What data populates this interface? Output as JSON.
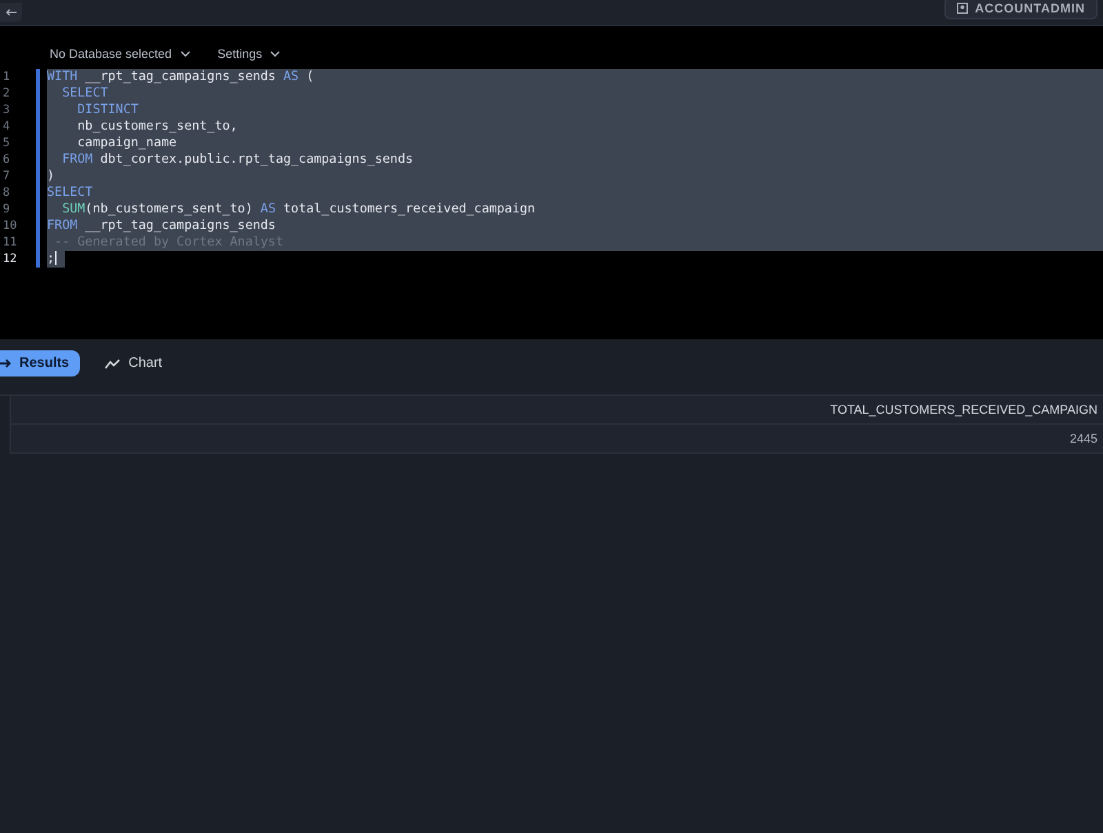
{
  "top_bar": {
    "role_button": "ACCOUNTADMIN"
  },
  "toolbar": {
    "database": "No Database selected",
    "settings": "Settings"
  },
  "editor": {
    "lines": [
      {
        "number": "1",
        "selected": true,
        "current": false,
        "tokens": [
          {
            "kind": "keyword",
            "text": "WITH"
          },
          {
            "kind": "plain",
            "text": " __rpt_tag_campaigns_sends "
          },
          {
            "kind": "keyword",
            "text": "AS"
          },
          {
            "kind": "plain",
            "text": " ("
          }
        ]
      },
      {
        "number": "2",
        "selected": true,
        "current": false,
        "tokens": [
          {
            "kind": "keyword",
            "text": "  SELECT"
          }
        ]
      },
      {
        "number": "3",
        "selected": true,
        "current": false,
        "tokens": [
          {
            "kind": "keyword",
            "text": "    DISTINCT"
          }
        ]
      },
      {
        "number": "4",
        "selected": true,
        "current": false,
        "tokens": [
          {
            "kind": "plain",
            "text": "    nb_customers_sent_to,"
          }
        ]
      },
      {
        "number": "5",
        "selected": true,
        "current": false,
        "tokens": [
          {
            "kind": "plain",
            "text": "    campaign_name"
          }
        ]
      },
      {
        "number": "6",
        "selected": true,
        "current": false,
        "tokens": [
          {
            "kind": "keyword",
            "text": "  FROM"
          },
          {
            "kind": "plain",
            "text": " dbt_cortex.public.rpt_tag_campaigns_sends"
          }
        ]
      },
      {
        "number": "7",
        "selected": true,
        "current": false,
        "tokens": [
          {
            "kind": "plain",
            "text": ")"
          }
        ]
      },
      {
        "number": "8",
        "selected": true,
        "current": false,
        "tokens": [
          {
            "kind": "keyword",
            "text": "SELECT"
          }
        ]
      },
      {
        "number": "9",
        "selected": true,
        "current": false,
        "tokens": [
          {
            "kind": "function",
            "text": "  SUM"
          },
          {
            "kind": "plain",
            "text": "(nb_customers_sent_to) "
          },
          {
            "kind": "keyword",
            "text": "AS"
          },
          {
            "kind": "plain",
            "text": " total_customers_received_campaign"
          }
        ]
      },
      {
        "number": "10",
        "selected": true,
        "current": false,
        "tokens": [
          {
            "kind": "keyword",
            "text": "FROM"
          },
          {
            "kind": "plain",
            "text": " __rpt_tag_campaigns_sends"
          }
        ]
      },
      {
        "number": "11",
        "selected": true,
        "current": false,
        "tokens": [
          {
            "kind": "comment",
            "text": " -- Generated by Cortex Analyst"
          }
        ]
      },
      {
        "number": "12",
        "selected": true,
        "current": true,
        "tokens": [
          {
            "kind": "plain",
            "text": ";"
          }
        ]
      }
    ]
  },
  "result_tabs": [
    {
      "label": "Results",
      "selected": true
    },
    {
      "label": "Chart",
      "selected": false
    }
  ],
  "table": {
    "columns": [
      "TOTAL_CUSTOMERS_RECEIVED_CAMPAIGN"
    ],
    "rows": [
      [
        "2445"
      ]
    ]
  }
}
